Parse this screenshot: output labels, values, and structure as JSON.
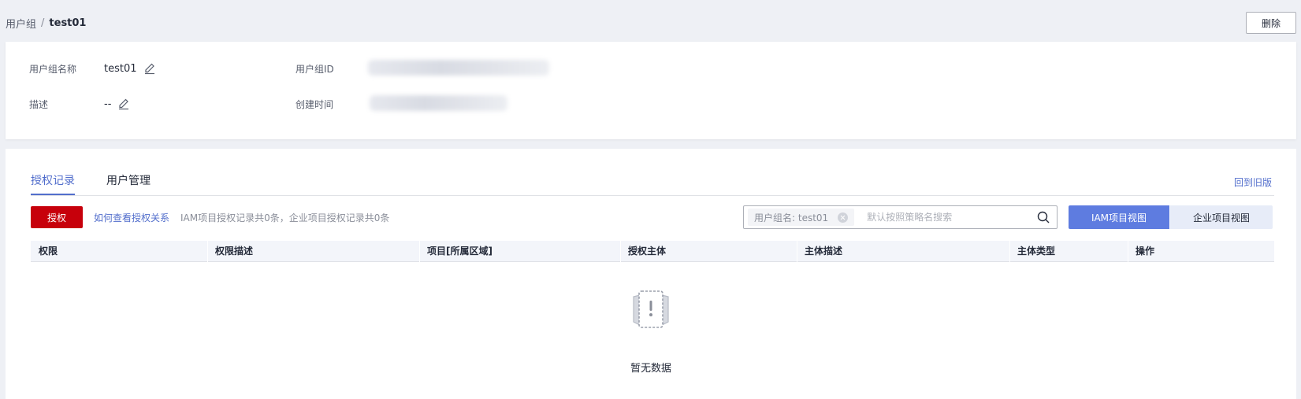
{
  "breadcrumb": {
    "parent": "用户组",
    "separator": "/",
    "current": "test01"
  },
  "header": {
    "delete_label": "删除"
  },
  "info": {
    "name_label": "用户组名称",
    "name_value": "test01",
    "id_label": "用户组ID",
    "desc_label": "描述",
    "desc_value": "--",
    "created_label": "创建时间"
  },
  "tabs": [
    {
      "label": "授权记录",
      "active": true
    },
    {
      "label": "用户管理",
      "active": false
    }
  ],
  "back_link": "回到旧版",
  "toolbar": {
    "grant_label": "授权",
    "how_link": "如何查看授权关系",
    "count_text": "IAM项目授权记录共0条，企业项目授权记录共0条"
  },
  "search": {
    "chip_label": "用户组名: test01",
    "placeholder": "默认按照策略名搜索"
  },
  "views": {
    "iam_label": "IAM项目视图",
    "enterprise_label": "企业项目视图"
  },
  "table": {
    "columns": [
      "权限",
      "权限描述",
      "项目[所属区域]",
      "授权主体",
      "主体描述",
      "主体类型",
      "操作"
    ],
    "rows": []
  },
  "empty": {
    "text": "暂无数据",
    "icon": "empty-data-icon"
  },
  "colors": {
    "primary": "#526ecc",
    "danger": "#c7000b",
    "view_active": "#5e7ce0"
  }
}
